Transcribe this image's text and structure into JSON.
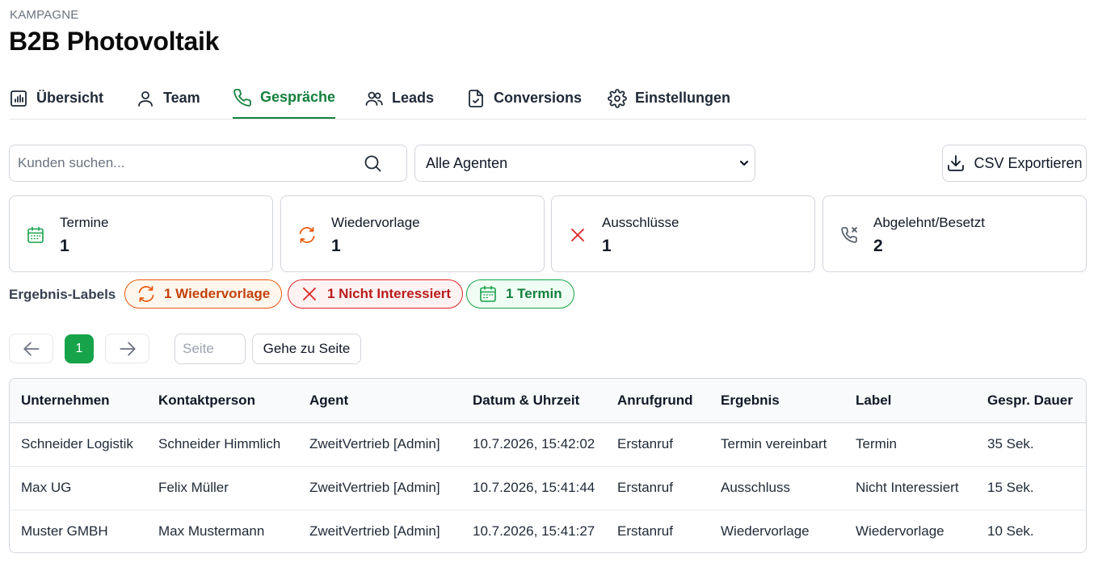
{
  "header": {
    "overline": "KAMPAGNE",
    "title": "B2B Photovoltaik"
  },
  "tabs": [
    {
      "label": "Übersicht",
      "icon": "bar-chart-icon",
      "active": false
    },
    {
      "label": "Team",
      "icon": "user-icon",
      "active": false
    },
    {
      "label": "Gespräche",
      "icon": "phone-icon",
      "active": true
    },
    {
      "label": "Leads",
      "icon": "users-icon",
      "active": false
    },
    {
      "label": "Conversions",
      "icon": "file-check-icon",
      "active": false
    },
    {
      "label": "Einstellungen",
      "icon": "gear-icon",
      "active": false
    }
  ],
  "toolbar": {
    "search_placeholder": "Kunden suchen...",
    "agent_select_value": "Alle Agenten",
    "csv_label": "CSV Exportieren"
  },
  "stats": [
    {
      "label": "Termine",
      "value": "1",
      "icon": "calendar-icon",
      "color": "#16a34a"
    },
    {
      "label": "Wiedervorlage",
      "value": "1",
      "icon": "refresh-icon",
      "color": "#ea580c"
    },
    {
      "label": "Ausschlüsse",
      "value": "1",
      "icon": "x-icon",
      "color": "#dc2626"
    },
    {
      "label": "Abgelehnt/Besetzt",
      "value": "2",
      "icon": "phone-x-icon",
      "color": "#4b5563"
    }
  ],
  "result_labels": {
    "title": "Ergebnis-Labels",
    "chips": [
      {
        "label": "1 Wiedervorlage",
        "icon": "refresh-icon",
        "color": "#ea580c"
      },
      {
        "label": "1 Nicht Interessiert",
        "icon": "x-icon",
        "color": "#dc2626"
      },
      {
        "label": "1 Termin",
        "icon": "calendar-icon",
        "color": "#16a34a"
      }
    ]
  },
  "pagination": {
    "current_page": "1",
    "page_placeholder": "Seite",
    "goto_label": "Gehe zu Seite"
  },
  "table": {
    "columns": [
      "Unternehmen",
      "Kontaktperson",
      "Agent",
      "Datum & Uhrzeit",
      "Anrufgrund",
      "Ergebnis",
      "Label",
      "Gespr. Dauer"
    ],
    "rows": [
      [
        "Schneider Logistik",
        "Schneider Himmlich",
        "ZweitVertrieb [Admin]",
        "10.7.2026, 15:42:02",
        "Erstanruf",
        "Termin vereinbart",
        "Termin",
        "35 Sek."
      ],
      [
        "Max UG",
        "Felix Müller",
        "ZweitVertrieb [Admin]",
        "10.7.2026, 15:41:44",
        "Erstanruf",
        "Ausschluss",
        "Nicht Interessiert",
        "15 Sek."
      ],
      [
        "Muster GMBH",
        "Max Mustermann",
        "ZweitVertrieb [Admin]",
        "10.7.2026, 15:41:27",
        "Erstanruf",
        "Wiedervorlage",
        "Wiedervorlage",
        "10 Sek."
      ]
    ]
  },
  "colors": {
    "accent": "#15803d",
    "border": "#d1d5db"
  }
}
